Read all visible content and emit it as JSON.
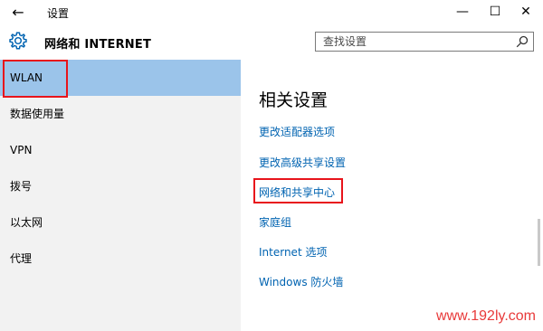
{
  "window": {
    "title": "设置",
    "back_symbol": "←",
    "minimize_symbol": "—",
    "maximize_symbol": "☐",
    "close_symbol": "✕"
  },
  "header": {
    "title": "网络和 INTERNET",
    "icon": "gear-icon"
  },
  "search": {
    "placeholder": "查找设置",
    "value": "",
    "icon": "search-icon"
  },
  "sidebar": {
    "items": [
      {
        "label": "WLAN",
        "selected": true,
        "highlighted": true
      },
      {
        "label": "数据使用量",
        "selected": false
      },
      {
        "label": "VPN",
        "selected": false
      },
      {
        "label": "拨号",
        "selected": false
      },
      {
        "label": "以太网",
        "selected": false
      },
      {
        "label": "代理",
        "selected": false
      }
    ]
  },
  "main": {
    "section_title": "相关设置",
    "links": [
      {
        "label": "更改适配器选项"
      },
      {
        "label": "更改高级共享设置"
      },
      {
        "label": "网络和共享中心",
        "highlighted": true
      },
      {
        "label": "家庭组"
      },
      {
        "label": "Internet 选项"
      },
      {
        "label": "Windows 防火墙"
      }
    ]
  },
  "watermark": "www.192ly.com",
  "colors": {
    "accent": "#0063b1",
    "selected_bg": "#9bc4ea",
    "sidebar_bg": "#f2f2f2",
    "highlight_box": "#e8141b",
    "watermark": "#e83a3a"
  }
}
